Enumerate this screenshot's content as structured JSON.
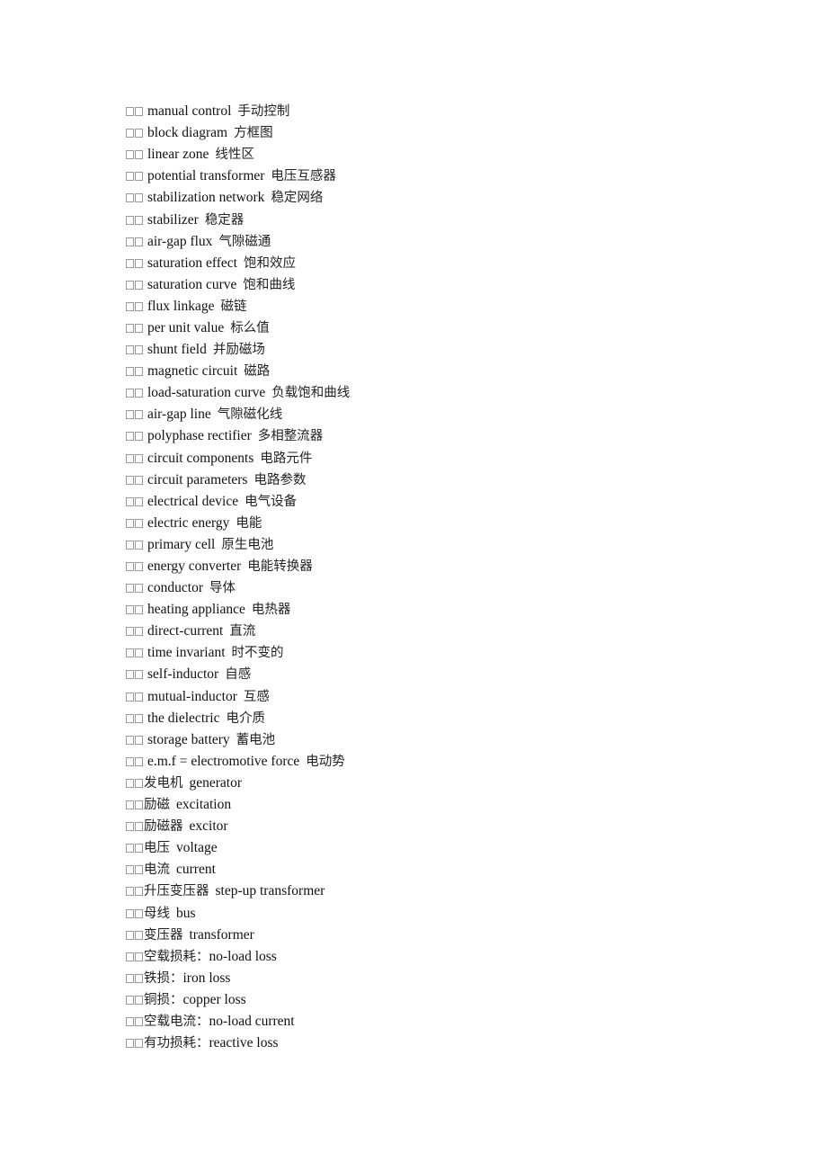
{
  "document": {
    "bullet_glyph": "□□",
    "entries": [
      {
        "first": "manual control",
        "second": "手动控制",
        "order": "en-zh"
      },
      {
        "first": "block diagram",
        "second": "方框图",
        "order": "en-zh"
      },
      {
        "first": "linear zone",
        "second": "线性区",
        "order": "en-zh"
      },
      {
        "first": "potential transformer",
        "second": "电压互感器",
        "order": "en-zh"
      },
      {
        "first": "stabilization network",
        "second": "稳定网络",
        "order": "en-zh"
      },
      {
        "first": "stabilizer",
        "second": "稳定器",
        "order": "en-zh"
      },
      {
        "first": "air-gap flux",
        "second": "气隙磁通",
        "order": "en-zh"
      },
      {
        "first": "saturation effect",
        "second": "饱和效应",
        "order": "en-zh"
      },
      {
        "first": "saturation curve",
        "second": "饱和曲线",
        "order": "en-zh"
      },
      {
        "first": "flux linkage",
        "second": "磁链",
        "order": "en-zh"
      },
      {
        "first": "per unit value",
        "second": "标么值",
        "order": "en-zh"
      },
      {
        "first": "shunt field",
        "second": "并励磁场",
        "order": "en-zh"
      },
      {
        "first": "magnetic circuit",
        "second": "磁路",
        "order": "en-zh"
      },
      {
        "first": "load-saturation curve",
        "second": "负载饱和曲线",
        "order": "en-zh"
      },
      {
        "first": "air-gap line",
        "second": "气隙磁化线",
        "order": "en-zh"
      },
      {
        "first": "polyphase rectifier",
        "second": "多相整流器",
        "order": "en-zh"
      },
      {
        "first": "circuit components",
        "second": "电路元件",
        "order": "en-zh"
      },
      {
        "first": "circuit parameters",
        "second": "电路参数",
        "order": "en-zh"
      },
      {
        "first": "electrical device",
        "second": "电气设备",
        "order": "en-zh"
      },
      {
        "first": "electric energy",
        "second": "电能",
        "order": "en-zh"
      },
      {
        "first": "primary cell",
        "second": "原生电池",
        "order": "en-zh"
      },
      {
        "first": "energy converter",
        "second": "电能转换器",
        "order": "en-zh"
      },
      {
        "first": "conductor",
        "second": "导体",
        "order": "en-zh"
      },
      {
        "first": "heating appliance",
        "second": "电热器",
        "order": "en-zh"
      },
      {
        "first": "direct-current",
        "second": "直流",
        "order": "en-zh"
      },
      {
        "first": "time invariant",
        "second": "时不变的",
        "order": "en-zh"
      },
      {
        "first": "self-inductor",
        "second": "自感",
        "order": "en-zh"
      },
      {
        "first": "mutual-inductor",
        "second": "互感",
        "order": "en-zh"
      },
      {
        "first": "the dielectric",
        "second": "电介质",
        "order": "en-zh"
      },
      {
        "first": "storage battery",
        "second": "蓄电池",
        "order": "en-zh"
      },
      {
        "first": "e.m.f = electromotive force",
        "second": "电动势",
        "order": "en-zh"
      },
      {
        "first": "发电机",
        "second": "generator",
        "order": "zh-en"
      },
      {
        "first": "励磁",
        "second": "excitation",
        "order": "zh-en"
      },
      {
        "first": "励磁器",
        "second": "excitor",
        "order": "zh-en"
      },
      {
        "first": "电压",
        "second": "voltage",
        "order": "zh-en"
      },
      {
        "first": "电流",
        "second": "current",
        "order": "zh-en"
      },
      {
        "first": "升压变压器",
        "second": "step-up transformer",
        "order": "zh-en"
      },
      {
        "first": "母线",
        "second": "bus",
        "order": "zh-en"
      },
      {
        "first": "变压器",
        "second": "transformer",
        "order": "zh-en"
      },
      {
        "first": "空载损耗：",
        "second": "no-load loss",
        "order": "zh-en-colon"
      },
      {
        "first": "铁损：",
        "second": "iron loss",
        "order": "zh-en-colon"
      },
      {
        "first": "铜损：",
        "second": "copper loss",
        "order": "zh-en-colon"
      },
      {
        "first": "空载电流：",
        "second": "no-load current",
        "order": "zh-en-colon"
      },
      {
        "first": "有功损耗：",
        "second": "reactive loss",
        "order": "zh-en-colon"
      }
    ]
  }
}
